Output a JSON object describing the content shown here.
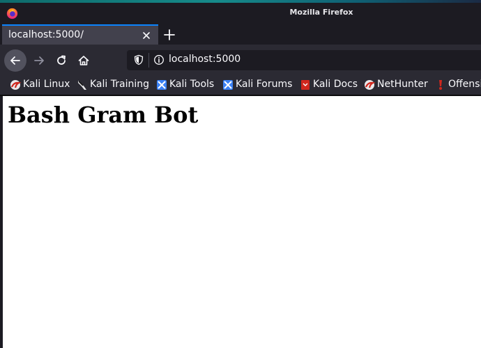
{
  "window": {
    "title": "Mozilla Firefox"
  },
  "tab": {
    "title": "localhost:5000/"
  },
  "urlbar": {
    "url": "localhost:5000"
  },
  "bookmarks": [
    {
      "label": "Kali Linux",
      "icon": "kali-dragon-icon"
    },
    {
      "label": "Kali Training",
      "icon": "kali-training-icon"
    },
    {
      "label": "Kali Tools",
      "icon": "kali-tools-icon"
    },
    {
      "label": "Kali Forums",
      "icon": "kali-forums-icon"
    },
    {
      "label": "Kali Docs",
      "icon": "kali-docs-icon"
    },
    {
      "label": "NetHunter",
      "icon": "nethunter-icon"
    },
    {
      "label": "Offensi",
      "icon": "offensive-security-icon"
    }
  ],
  "page": {
    "heading": "Bash Gram Bot"
  },
  "colors": {
    "accent": "#0a84ff",
    "chrome": "#2b2a33",
    "titlebar": "#1c1b22"
  }
}
